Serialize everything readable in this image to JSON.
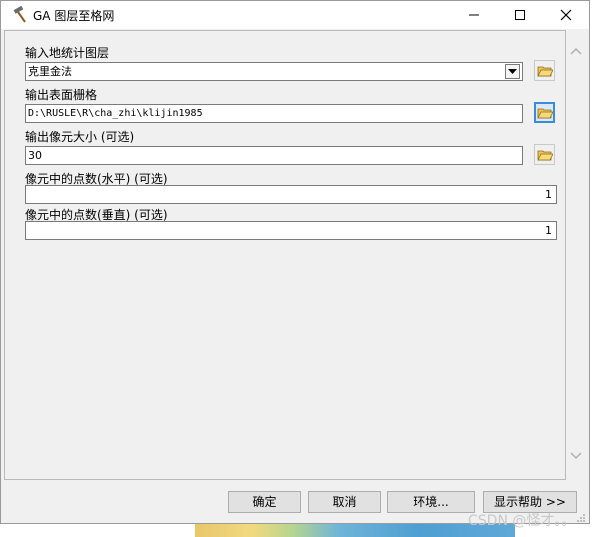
{
  "window": {
    "title": "GA 图层至格网",
    "icons": {
      "app": "hammer-icon",
      "minimize": "minimize-icon",
      "maximize": "maximize-icon",
      "close": "close-icon"
    }
  },
  "form": {
    "input_layer": {
      "label": "输入地统计图层",
      "value": "克里金法"
    },
    "output_raster": {
      "label": "输出表面栅格",
      "value": "D:\\RUSLE\\R\\cha_zhi\\klijin1985"
    },
    "cell_size": {
      "label": "输出像元大小 (可选)",
      "value": "30"
    },
    "points_horizontal": {
      "label": "像元中的点数(水平) (可选)",
      "value": "1"
    },
    "points_vertical": {
      "label": "像元中的点数(垂直) (可选)",
      "value": "1"
    }
  },
  "buttons": {
    "ok": "确定",
    "cancel": "取消",
    "environments": "环境...",
    "show_help": "显示帮助 >>"
  },
  "watermark": "CSDN @怪才。。",
  "colors": {
    "browse_active_border": "#3c8bd9",
    "folder": "#f2c14e"
  }
}
